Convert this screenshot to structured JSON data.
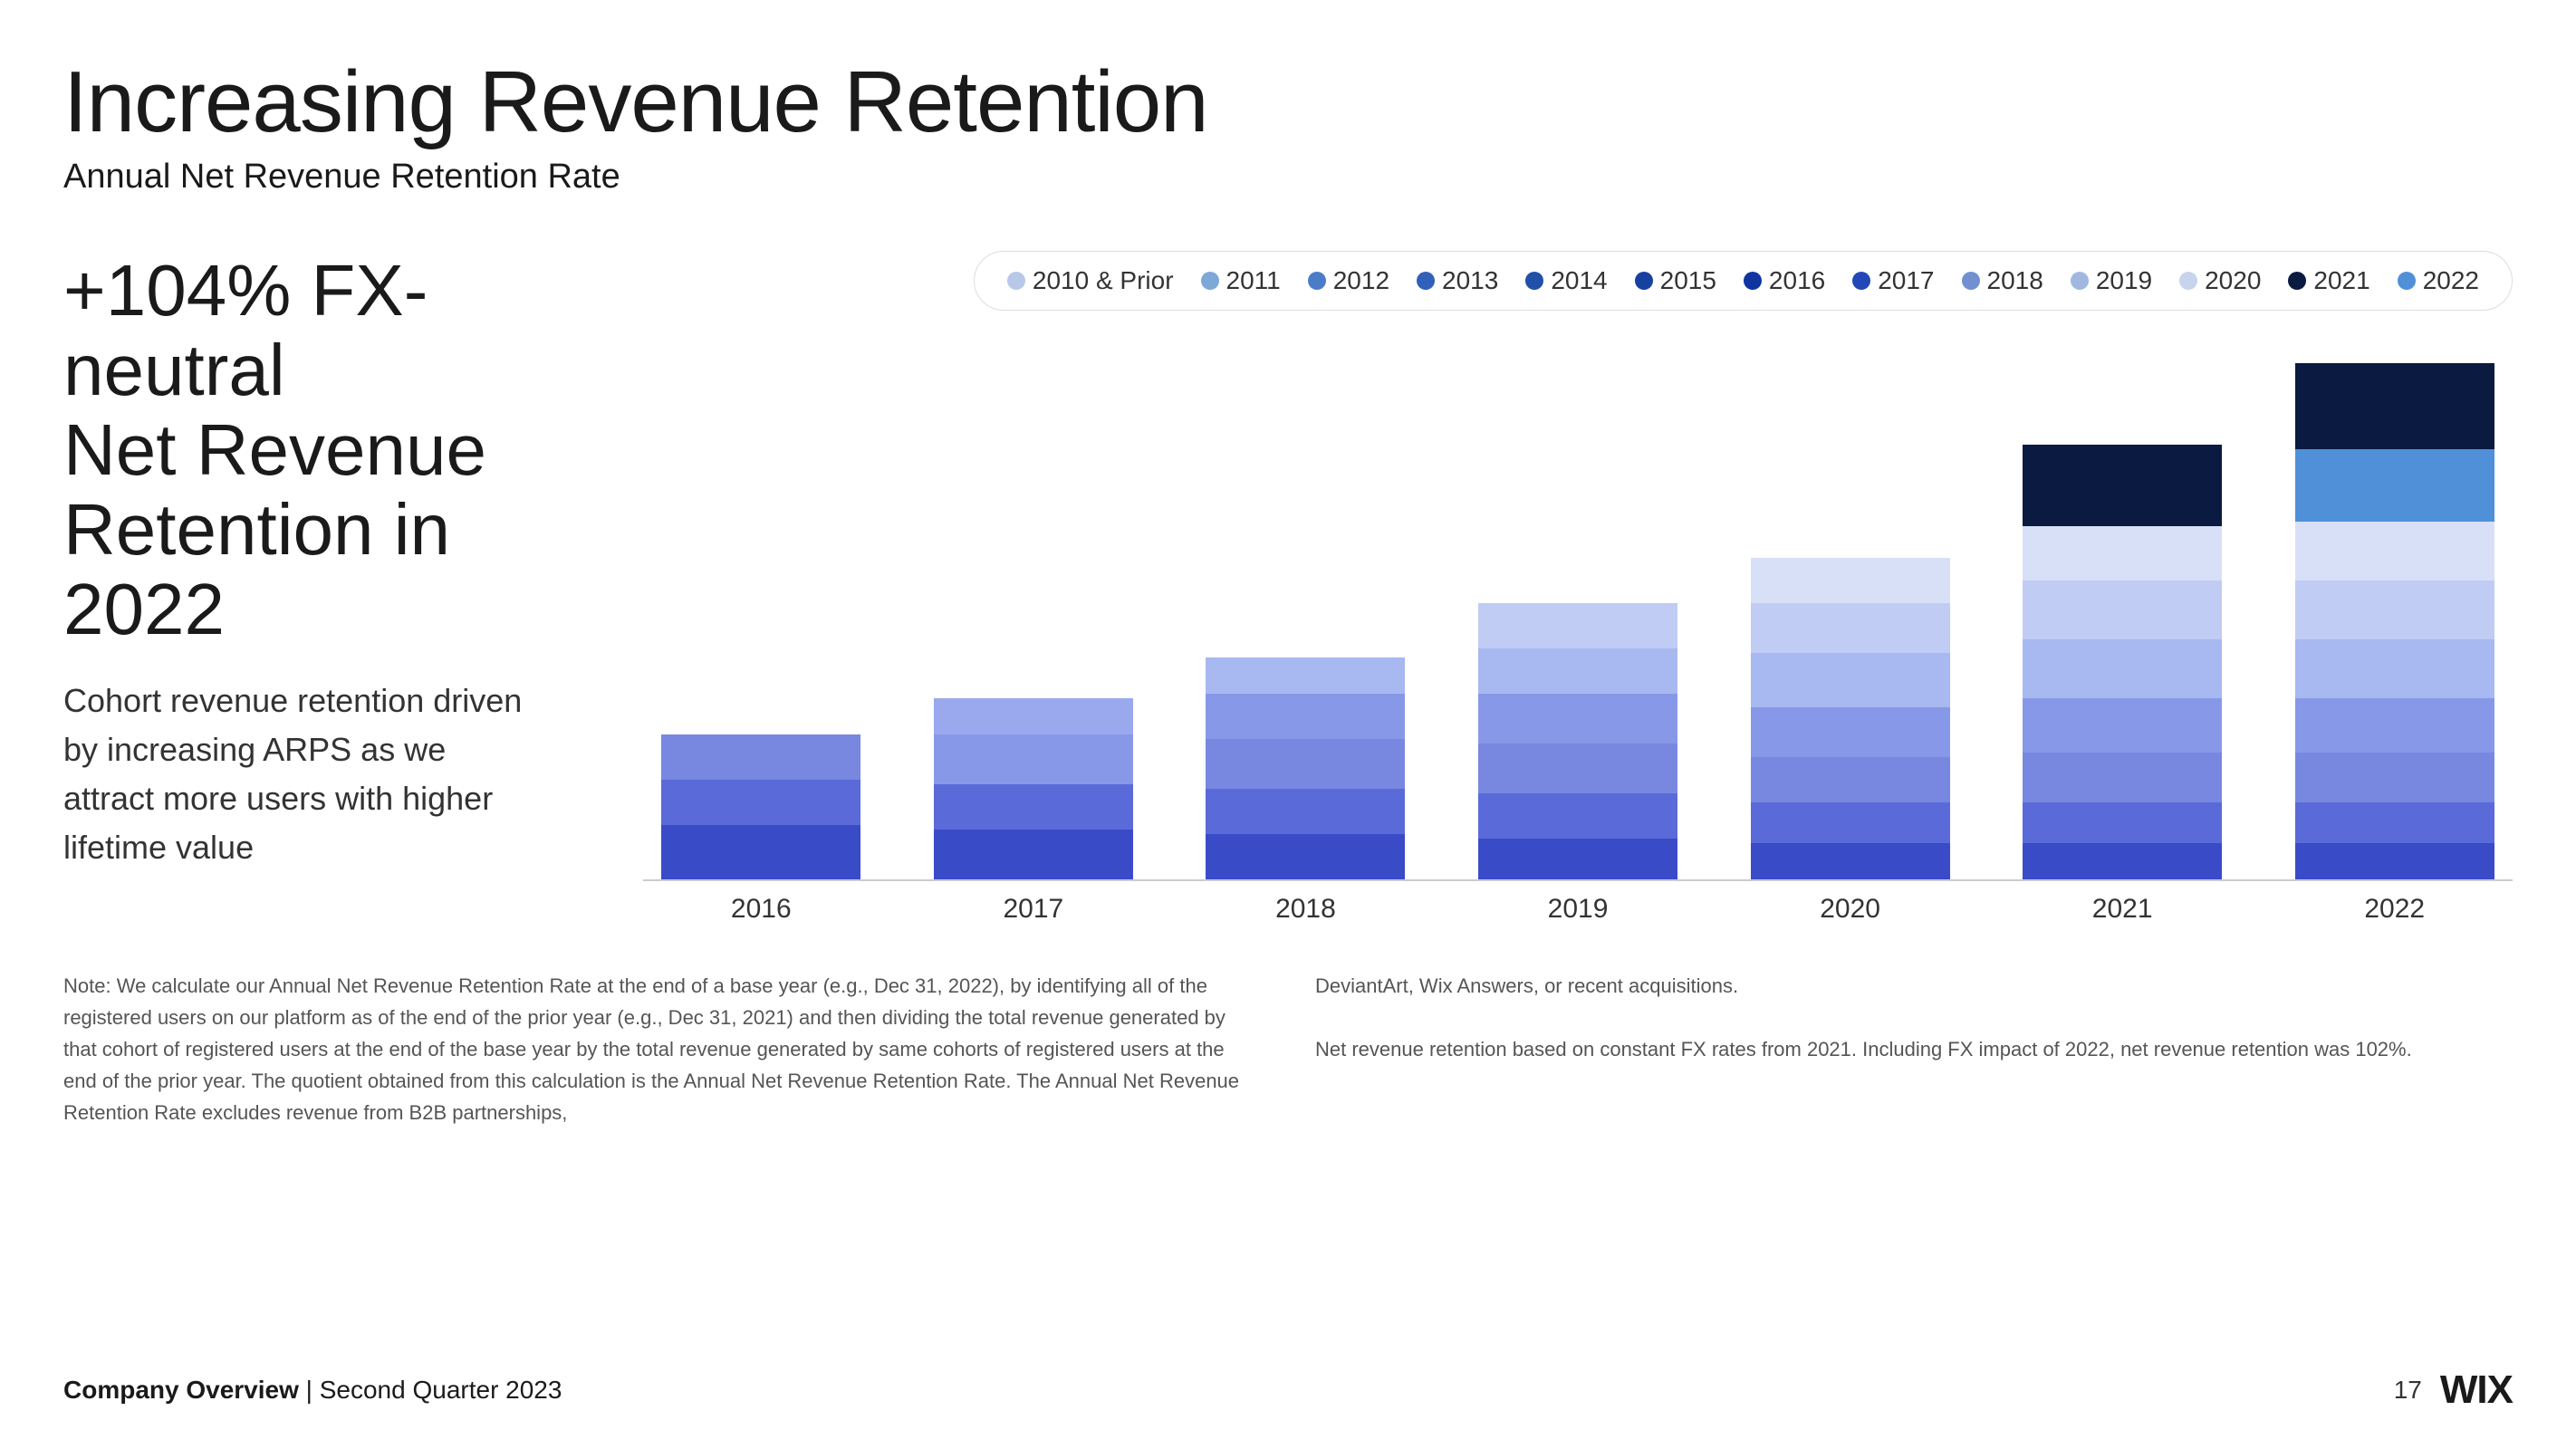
{
  "page": {
    "title": "Increasing Revenue Retention",
    "subtitle": "Annual Net Revenue Retention Rate"
  },
  "stat": {
    "line1": "+104% FX-neutral",
    "line2": "Net Revenue Retention in 2022"
  },
  "description": "Cohort revenue retention driven by increasing ARPS as we attract more users with higher lifetime value",
  "legend": {
    "items": [
      {
        "id": "2010prior",
        "label": "2010 & Prior",
        "color": "#b8c8e8"
      },
      {
        "id": "2011",
        "label": "2011",
        "color": "#7da8d8"
      },
      {
        "id": "2012",
        "label": "2012",
        "color": "#4a7cc8"
      },
      {
        "id": "2013",
        "label": "2013",
        "color": "#3060b8"
      },
      {
        "id": "2014",
        "label": "2014",
        "color": "#2050a8"
      },
      {
        "id": "2015",
        "label": "2015",
        "color": "#1840a0"
      },
      {
        "id": "2016",
        "label": "2016",
        "color": "#1035a0"
      },
      {
        "id": "2017",
        "label": "2017",
        "color": "#2248b8"
      },
      {
        "id": "2018",
        "label": "2018",
        "color": "#7090d0"
      },
      {
        "id": "2019",
        "label": "2019",
        "color": "#a0b8e0"
      },
      {
        "id": "2020",
        "label": "2020",
        "color": "#c8d4ec"
      },
      {
        "id": "2021",
        "label": "2021",
        "color": "#0a1a40"
      },
      {
        "id": "2022",
        "label": "2022",
        "color": "#5090d8"
      }
    ]
  },
  "bars": [
    {
      "year": "2016",
      "segments": [
        {
          "color": "#3a4bc8",
          "height": 60
        },
        {
          "color": "#5a6ad8",
          "height": 50
        },
        {
          "color": "#7888e0",
          "height": 50
        }
      ]
    },
    {
      "year": "2017",
      "segments": [
        {
          "color": "#3a4bc8",
          "height": 55
        },
        {
          "color": "#5a6ad8",
          "height": 50
        },
        {
          "color": "#8898e8",
          "height": 55
        },
        {
          "color": "#9aa8ee",
          "height": 40
        }
      ]
    },
    {
      "year": "2018",
      "segments": [
        {
          "color": "#3a4bc8",
          "height": 50
        },
        {
          "color": "#5a6ad8",
          "height": 50
        },
        {
          "color": "#7888e0",
          "height": 55
        },
        {
          "color": "#8898e8",
          "height": 50
        },
        {
          "color": "#a8b8f0",
          "height": 40
        }
      ]
    },
    {
      "year": "2019",
      "segments": [
        {
          "color": "#3a4bc8",
          "height": 45
        },
        {
          "color": "#5a6ad8",
          "height": 50
        },
        {
          "color": "#7888e0",
          "height": 55
        },
        {
          "color": "#8898e8",
          "height": 55
        },
        {
          "color": "#a8b8f0",
          "height": 50
        },
        {
          "color": "#c0ccf4",
          "height": 50
        }
      ]
    },
    {
      "year": "2020",
      "segments": [
        {
          "color": "#3a4bc8",
          "height": 40
        },
        {
          "color": "#5a6ad8",
          "height": 45
        },
        {
          "color": "#7888e0",
          "height": 50
        },
        {
          "color": "#8898e8",
          "height": 55
        },
        {
          "color": "#a8b8f0",
          "height": 60
        },
        {
          "color": "#c0ccf4",
          "height": 55
        },
        {
          "color": "#d8e0f8",
          "height": 50
        }
      ]
    },
    {
      "year": "2021",
      "segments": [
        {
          "color": "#3a4bc8",
          "height": 40
        },
        {
          "color": "#5a6ad8",
          "height": 45
        },
        {
          "color": "#7888e0",
          "height": 55
        },
        {
          "color": "#8898e8",
          "height": 60
        },
        {
          "color": "#a8b8f0",
          "height": 65
        },
        {
          "color": "#c0ccf4",
          "height": 65
        },
        {
          "color": "#d8e0f8",
          "height": 60
        },
        {
          "color": "#0a1a40",
          "height": 90
        }
      ]
    },
    {
      "year": "2022",
      "segments": [
        {
          "color": "#3a4bc8",
          "height": 40
        },
        {
          "color": "#5a6ad8",
          "height": 45
        },
        {
          "color": "#7888e0",
          "height": 55
        },
        {
          "color": "#8898e8",
          "height": 60
        },
        {
          "color": "#a8b8f0",
          "height": 65
        },
        {
          "color": "#c0ccf4",
          "height": 65
        },
        {
          "color": "#d8e0f8",
          "height": 65
        },
        {
          "color": "#5090d8",
          "height": 80
        },
        {
          "color": "#0a1a40",
          "height": 95
        }
      ]
    }
  ],
  "footnote": {
    "left": "Note: We calculate our Annual Net Revenue Retention Rate at the end of a base year (e.g., Dec 31, 2022), by identifying all of the registered users on our platform as of the end of the prior year (e.g., Dec 31, 2021) and then dividing the total revenue generated by that cohort of registered users at the end of the base year by the total revenue generated by same cohorts of registered users at the end of the prior year. The quotient obtained from this calculation is the Annual Net Revenue Retention Rate. The Annual Net Revenue Retention Rate excludes revenue from B2B partnerships,",
    "right_1": "DeviantArt, Wix Answers, or recent acquisitions.",
    "right_2": "Net revenue retention based on constant FX rates from 2021. Including FX impact of 2022, net revenue retention was 102%."
  },
  "footer": {
    "company": "Company Overview",
    "period": "Second Quarter 2023",
    "page_number": "17",
    "logo": "WIX"
  }
}
